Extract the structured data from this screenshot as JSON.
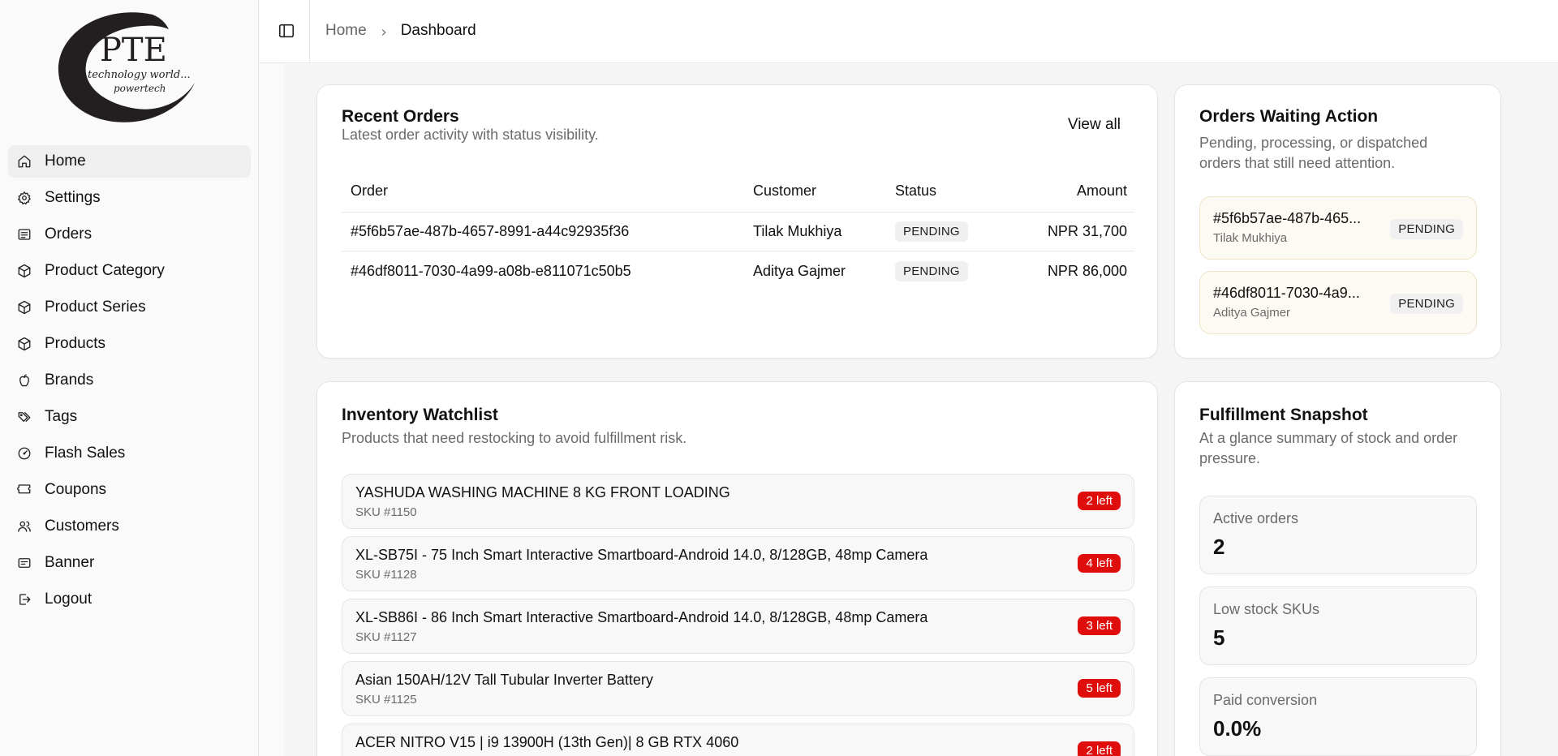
{
  "brand": {
    "logo_text": "PTE",
    "logo_tagline": "technology world...",
    "logo_subtagline": "powertech"
  },
  "sidebar": {
    "items": [
      {
        "label": "Home",
        "icon": "home-icon",
        "active": true
      },
      {
        "label": "Settings",
        "icon": "gear-icon"
      },
      {
        "label": "Orders",
        "icon": "receipt-icon"
      },
      {
        "label": "Product Category",
        "icon": "box-icon"
      },
      {
        "label": "Product Series",
        "icon": "box-icon"
      },
      {
        "label": "Products",
        "icon": "box-icon"
      },
      {
        "label": "Brands",
        "icon": "apple-icon"
      },
      {
        "label": "Tags",
        "icon": "tags-icon"
      },
      {
        "label": "Flash Sales",
        "icon": "gauge-icon"
      },
      {
        "label": "Coupons",
        "icon": "ticket-icon"
      },
      {
        "label": "Customers",
        "icon": "users-icon"
      },
      {
        "label": "Banner",
        "icon": "banner-icon"
      },
      {
        "label": "Logout",
        "icon": "logout-icon"
      }
    ]
  },
  "header": {
    "breadcrumb": {
      "home": "Home",
      "current": "Dashboard"
    }
  },
  "recent_orders": {
    "title": "Recent Orders",
    "subtitle": "Latest order activity with status visibility.",
    "view_all": "View all",
    "columns": [
      "Order",
      "Customer",
      "Status",
      "Amount"
    ],
    "rows": [
      {
        "order": "#5f6b57ae-487b-4657-8991-a44c92935f36",
        "customer": "Tilak Mukhiya",
        "status": "PENDING",
        "amount": "NPR 31,700"
      },
      {
        "order": "#46df8011-7030-4a99-a08b-e811071c50b5",
        "customer": "Aditya Gajmer",
        "status": "PENDING",
        "amount": "NPR 86,000"
      }
    ]
  },
  "orders_waiting": {
    "title": "Orders Waiting Action",
    "subtitle_line1": "Pending, processing, or dispatched",
    "subtitle_line2": "orders that still need attention.",
    "items": [
      {
        "id": "#5f6b57ae-487b-465...",
        "name": "Tilak Mukhiya",
        "status": "PENDING"
      },
      {
        "id": "#46df8011-7030-4a9...",
        "name": "Aditya Gajmer",
        "status": "PENDING"
      }
    ]
  },
  "inventory": {
    "title": "Inventory Watchlist",
    "subtitle": "Products that need restocking to avoid fulfillment risk.",
    "items": [
      {
        "name": "YASHUDA WASHING MACHINE 8 KG FRONT LOADING",
        "sku": "SKU #1150",
        "badge": "2 left"
      },
      {
        "name": "XL-SB75I - 75 Inch Smart Interactive Smartboard-Android 14.0, 8/128GB, 48mp Camera",
        "sku": "SKU #1128",
        "badge": "4 left"
      },
      {
        "name": "XL-SB86I - 86 Inch Smart Interactive Smartboard-Android 14.0, 8/128GB, 48mp Camera",
        "sku": "SKU #1127",
        "badge": "3 left"
      },
      {
        "name": "Asian 150AH/12V Tall Tubular Inverter Battery",
        "sku": "SKU #1125",
        "badge": "5 left"
      },
      {
        "name": "ACER NITRO V15 | i9 13900H (13th Gen)| 8 GB RTX 4060",
        "sku": "",
        "badge": "2 left"
      }
    ]
  },
  "fulfillment": {
    "title": "Fulfillment Snapshot",
    "subtitle_line1": "At a glance summary of stock and order",
    "subtitle_line2": "pressure.",
    "stats": [
      {
        "label": "Active orders",
        "value": "2"
      },
      {
        "label": "Low stock SKUs",
        "value": "5"
      },
      {
        "label": "Paid conversion",
        "value": "0.0%"
      }
    ]
  },
  "colors": {
    "alert_red": "#e00d0d",
    "pending_bg": "#fdfaf3"
  }
}
